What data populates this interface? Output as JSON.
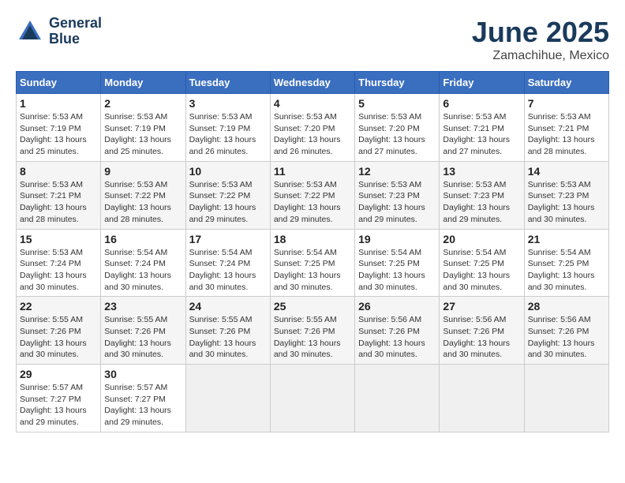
{
  "header": {
    "logo_line1": "General",
    "logo_line2": "Blue",
    "month": "June 2025",
    "location": "Zamachihue, Mexico"
  },
  "days_of_week": [
    "Sunday",
    "Monday",
    "Tuesday",
    "Wednesday",
    "Thursday",
    "Friday",
    "Saturday"
  ],
  "weeks": [
    [
      {
        "num": "1",
        "sunrise": "5:53 AM",
        "sunset": "7:19 PM",
        "daylight": "13 hours and 25 minutes."
      },
      {
        "num": "2",
        "sunrise": "5:53 AM",
        "sunset": "7:19 PM",
        "daylight": "13 hours and 25 minutes."
      },
      {
        "num": "3",
        "sunrise": "5:53 AM",
        "sunset": "7:19 PM",
        "daylight": "13 hours and 26 minutes."
      },
      {
        "num": "4",
        "sunrise": "5:53 AM",
        "sunset": "7:20 PM",
        "daylight": "13 hours and 26 minutes."
      },
      {
        "num": "5",
        "sunrise": "5:53 AM",
        "sunset": "7:20 PM",
        "daylight": "13 hours and 27 minutes."
      },
      {
        "num": "6",
        "sunrise": "5:53 AM",
        "sunset": "7:21 PM",
        "daylight": "13 hours and 27 minutes."
      },
      {
        "num": "7",
        "sunrise": "5:53 AM",
        "sunset": "7:21 PM",
        "daylight": "13 hours and 28 minutes."
      }
    ],
    [
      {
        "num": "8",
        "sunrise": "5:53 AM",
        "sunset": "7:21 PM",
        "daylight": "13 hours and 28 minutes."
      },
      {
        "num": "9",
        "sunrise": "5:53 AM",
        "sunset": "7:22 PM",
        "daylight": "13 hours and 28 minutes."
      },
      {
        "num": "10",
        "sunrise": "5:53 AM",
        "sunset": "7:22 PM",
        "daylight": "13 hours and 29 minutes."
      },
      {
        "num": "11",
        "sunrise": "5:53 AM",
        "sunset": "7:22 PM",
        "daylight": "13 hours and 29 minutes."
      },
      {
        "num": "12",
        "sunrise": "5:53 AM",
        "sunset": "7:23 PM",
        "daylight": "13 hours and 29 minutes."
      },
      {
        "num": "13",
        "sunrise": "5:53 AM",
        "sunset": "7:23 PM",
        "daylight": "13 hours and 29 minutes."
      },
      {
        "num": "14",
        "sunrise": "5:53 AM",
        "sunset": "7:23 PM",
        "daylight": "13 hours and 30 minutes."
      }
    ],
    [
      {
        "num": "15",
        "sunrise": "5:53 AM",
        "sunset": "7:24 PM",
        "daylight": "13 hours and 30 minutes."
      },
      {
        "num": "16",
        "sunrise": "5:54 AM",
        "sunset": "7:24 PM",
        "daylight": "13 hours and 30 minutes."
      },
      {
        "num": "17",
        "sunrise": "5:54 AM",
        "sunset": "7:24 PM",
        "daylight": "13 hours and 30 minutes."
      },
      {
        "num": "18",
        "sunrise": "5:54 AM",
        "sunset": "7:25 PM",
        "daylight": "13 hours and 30 minutes."
      },
      {
        "num": "19",
        "sunrise": "5:54 AM",
        "sunset": "7:25 PM",
        "daylight": "13 hours and 30 minutes."
      },
      {
        "num": "20",
        "sunrise": "5:54 AM",
        "sunset": "7:25 PM",
        "daylight": "13 hours and 30 minutes."
      },
      {
        "num": "21",
        "sunrise": "5:54 AM",
        "sunset": "7:25 PM",
        "daylight": "13 hours and 30 minutes."
      }
    ],
    [
      {
        "num": "22",
        "sunrise": "5:55 AM",
        "sunset": "7:26 PM",
        "daylight": "13 hours and 30 minutes."
      },
      {
        "num": "23",
        "sunrise": "5:55 AM",
        "sunset": "7:26 PM",
        "daylight": "13 hours and 30 minutes."
      },
      {
        "num": "24",
        "sunrise": "5:55 AM",
        "sunset": "7:26 PM",
        "daylight": "13 hours and 30 minutes."
      },
      {
        "num": "25",
        "sunrise": "5:55 AM",
        "sunset": "7:26 PM",
        "daylight": "13 hours and 30 minutes."
      },
      {
        "num": "26",
        "sunrise": "5:56 AM",
        "sunset": "7:26 PM",
        "daylight": "13 hours and 30 minutes."
      },
      {
        "num": "27",
        "sunrise": "5:56 AM",
        "sunset": "7:26 PM",
        "daylight": "13 hours and 30 minutes."
      },
      {
        "num": "28",
        "sunrise": "5:56 AM",
        "sunset": "7:26 PM",
        "daylight": "13 hours and 30 minutes."
      }
    ],
    [
      {
        "num": "29",
        "sunrise": "5:57 AM",
        "sunset": "7:27 PM",
        "daylight": "13 hours and 29 minutes."
      },
      {
        "num": "30",
        "sunrise": "5:57 AM",
        "sunset": "7:27 PM",
        "daylight": "13 hours and 29 minutes."
      },
      null,
      null,
      null,
      null,
      null
    ]
  ]
}
